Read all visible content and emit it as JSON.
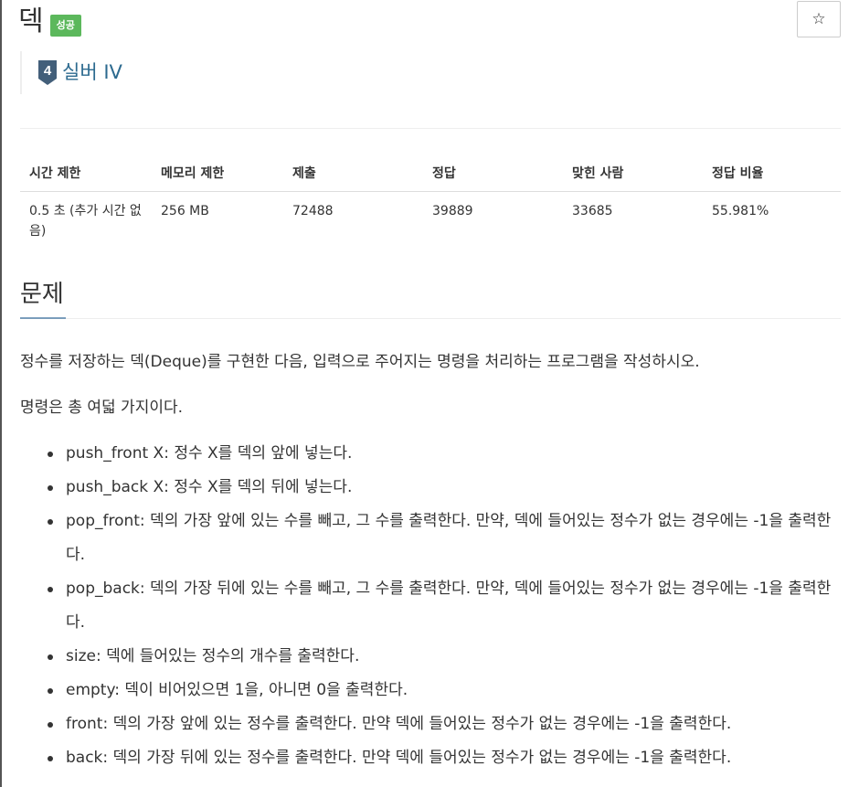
{
  "header": {
    "title": "덱",
    "status_badge": "성공",
    "star_icon": "☆",
    "tier_number": "4",
    "tier_label": "실버 IV",
    "tier_color": "#2c6a8f"
  },
  "info_table": {
    "headers": [
      "시간 제한",
      "메모리 제한",
      "제출",
      "정답",
      "맞힌 사람",
      "정답 비율"
    ],
    "values": [
      "0.5 초 (추가 시간 없음)",
      "256 MB",
      "72488",
      "39889",
      "33685",
      "55.981%"
    ]
  },
  "section": {
    "title": "문제"
  },
  "description": {
    "paragraph1": "정수를 저장하는 덱(Deque)를 구현한 다음, 입력으로 주어지는 명령을 처리하는 프로그램을 작성하시오.",
    "paragraph2": "명령은 총 여덟 가지이다.",
    "commands": [
      "push_front X: 정수 X를 덱의 앞에 넣는다.",
      "push_back X: 정수 X를 덱의 뒤에 넣는다.",
      "pop_front: 덱의 가장 앞에 있는 수를 빼고, 그 수를 출력한다. 만약, 덱에 들어있는 정수가 없는 경우에는 -1을 출력한다.",
      "pop_back: 덱의 가장 뒤에 있는 수를 빼고, 그 수를 출력한다. 만약, 덱에 들어있는 정수가 없는 경우에는 -1을 출력한다.",
      "size: 덱에 들어있는 정수의 개수를 출력한다.",
      "empty: 덱이 비어있으면 1을, 아니면 0을 출력한다.",
      "front: 덱의 가장 앞에 있는 정수를 출력한다. 만약 덱에 들어있는 정수가 없는 경우에는 -1을 출력한다.",
      "back: 덱의 가장 뒤에 있는 정수를 출력한다. 만약 덱에 들어있는 정수가 없는 경우에는 -1을 출력한다."
    ]
  },
  "colors": {
    "success_badge": "#5cb85c",
    "tier_badge": "#435f7a",
    "text": "#333333"
  }
}
